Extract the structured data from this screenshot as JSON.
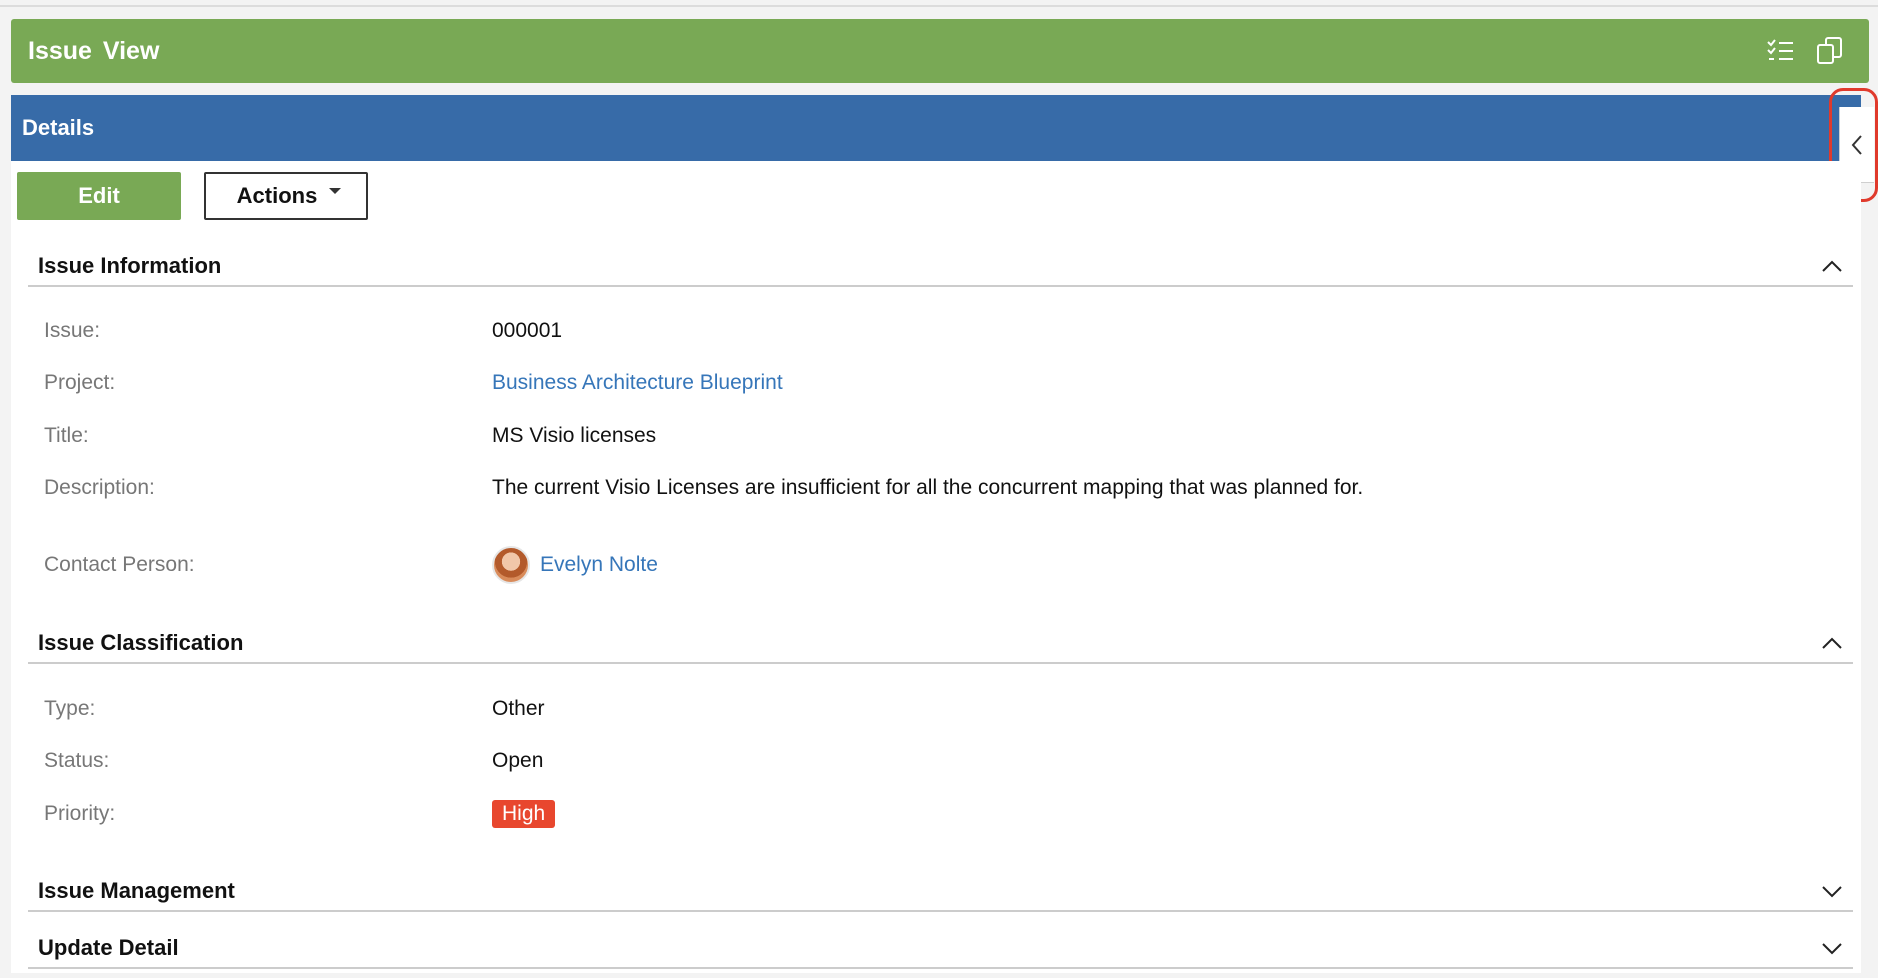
{
  "header": {
    "title": "Issue View",
    "icons": [
      "checklist-icon",
      "copy-icon"
    ]
  },
  "details_bar": {
    "title": "Details"
  },
  "toolbar": {
    "edit_label": "Edit",
    "actions_label": "Actions"
  },
  "sections": {
    "info": {
      "title": "Issue Information",
      "issue_label": "Issue:",
      "issue_value": "000001",
      "project_label": "Project:",
      "project_value": "Business Architecture Blueprint",
      "title_label": "Title:",
      "title_value": "MS Visio licenses",
      "description_label": "Description:",
      "description_value": "The current Visio Licenses are insufficient for all the concurrent mapping that was planned for.",
      "contact_label": "Contact Person:",
      "contact_value": "Evelyn Nolte"
    },
    "classification": {
      "title": "Issue Classification",
      "type_label": "Type:",
      "type_value": "Other",
      "status_label": "Status:",
      "status_value": "Open",
      "priority_label": "Priority:",
      "priority_value": "High"
    },
    "management": {
      "title": "Issue Management"
    },
    "update": {
      "title": "Update Detail"
    }
  },
  "colors": {
    "header_green": "#79a955",
    "details_blue": "#376ba8",
    "link_blue": "#3676b9",
    "priority_high": "#e8472e",
    "highlight_red": "#e03a2c"
  }
}
